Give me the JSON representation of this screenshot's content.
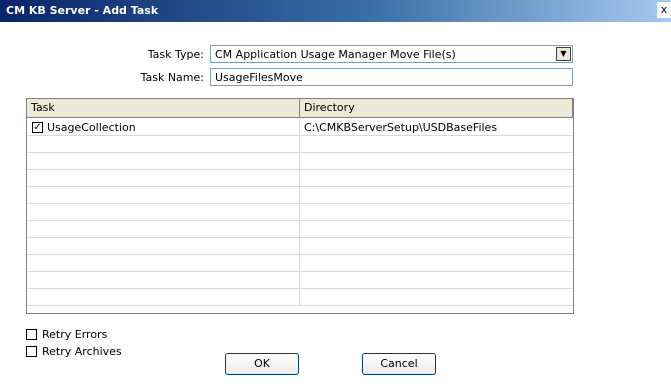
{
  "window": {
    "title": "CM KB Server - Add Task",
    "close_glyph": "x"
  },
  "form": {
    "task_type_label": "Task Type:",
    "task_type_value": "CM Application Usage Manager Move File(s)",
    "task_name_label": "Task Name:",
    "task_name_value": "UsageFilesMove"
  },
  "table": {
    "columns": [
      "Task",
      "Directory"
    ],
    "rows": [
      {
        "checked": true,
        "task": "UsageCollection",
        "directory": "C:\\CMKBServerSetup\\USDBaseFiles"
      }
    ]
  },
  "options": {
    "retry_errors_label": "Retry Errors",
    "retry_errors_checked": false,
    "retry_archives_label": "Retry Archives",
    "retry_archives_checked": false
  },
  "buttons": {
    "ok_label": "OK",
    "cancel_label": "Cancel"
  },
  "icons": {
    "combo_arrow": "dropdown-arrow-icon",
    "check": "checkmark-icon"
  }
}
